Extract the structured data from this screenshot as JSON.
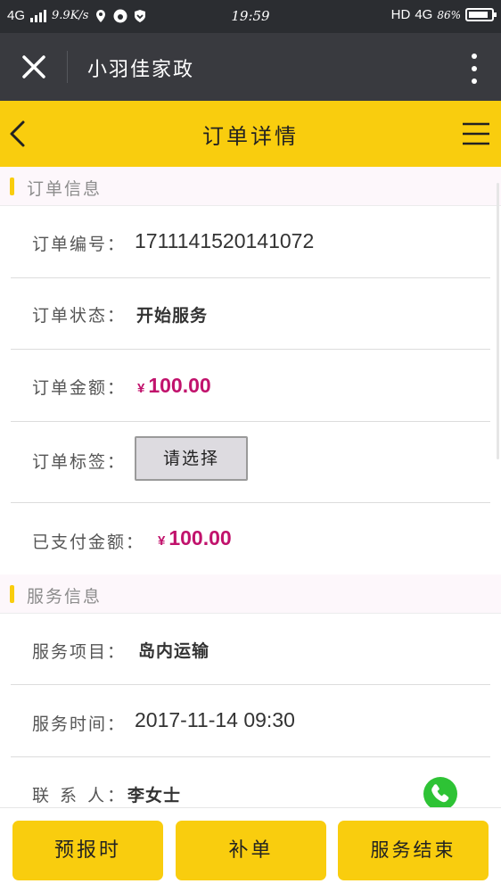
{
  "status_bar": {
    "network": "4G",
    "speed": "9.9K/s",
    "time": "19:59",
    "hd": "HD",
    "net_type": "4G",
    "battery_text": "86%",
    "battery_level": 0.86
  },
  "app_bar": {
    "title": "小羽佳家政",
    "close_icon": "close-icon",
    "more_icon": "more-vertical-icon"
  },
  "header": {
    "title": "订单详情",
    "back_icon": "chevron-left-icon",
    "menu_icon": "hamburger-menu-icon"
  },
  "order_section": {
    "title": "订单信息",
    "order_no_label": "订单编号：",
    "order_no": "1711141520141072",
    "status_label": "订单状态：",
    "status": "开始服务",
    "amount_label": "订单金额：",
    "amount_currency": "¥",
    "amount": "100.00",
    "tag_label": "订单标签：",
    "tag_select": "请选择",
    "paid_label": "已支付金额：",
    "paid_currency": "¥",
    "paid": "100.00"
  },
  "service_section": {
    "title": "服务信息",
    "item_label": "服务项目：",
    "item": "岛内运输",
    "time_label": "服务时间：",
    "time": "2017-11-14 09:30",
    "contact_label": "联 系 人：",
    "contact": "李女士",
    "phone_icon": "phone-icon"
  },
  "bottom_actions": {
    "report_time": "预报时",
    "supplement": "补单",
    "finish": "服务结束"
  },
  "colors": {
    "accent": "#f9cd0e",
    "money": "#c1126c",
    "app_bar": "#393a3f",
    "phone_green": "#2ec335"
  }
}
